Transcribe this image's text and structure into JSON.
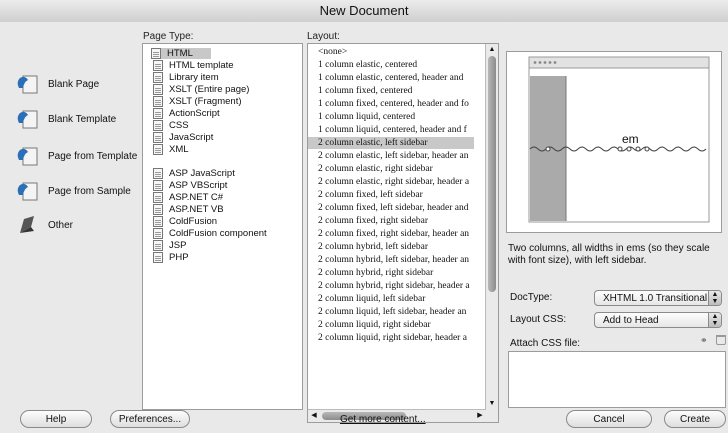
{
  "window": {
    "title": "New Document"
  },
  "categories": [
    {
      "label": "Blank Page",
      "icon": "blank-page-icon"
    },
    {
      "label": "Blank Template",
      "icon": "blank-template-icon"
    },
    {
      "label": "Page from Template",
      "icon": "page-from-template-icon"
    },
    {
      "label": "Page from Sample",
      "icon": "page-from-sample-icon"
    },
    {
      "label": "Other",
      "icon": "other-icon"
    }
  ],
  "page_type": {
    "heading": "Page Type:",
    "items": [
      "HTML",
      "HTML template",
      "Library item",
      "XSLT (Entire page)",
      "XSLT (Fragment)",
      "ActionScript",
      "CSS",
      "JavaScript",
      "XML",
      "ASP JavaScript",
      "ASP VBScript",
      "ASP.NET C#",
      "ASP.NET VB",
      "ColdFusion",
      "ColdFusion component",
      "JSP",
      "PHP"
    ],
    "selected": "HTML"
  },
  "layout": {
    "heading": "Layout:",
    "items": [
      "<none>",
      "1 column elastic, centered",
      "1 column elastic, centered, header and",
      "1 column fixed, centered",
      "1 column fixed, centered, header and fo",
      "1 column liquid, centered",
      "1 column liquid, centered, header and f",
      "2 column elastic, left sidebar",
      "2 column elastic, left sidebar, header an",
      "2 column elastic, right sidebar",
      "2 column elastic, right sidebar, header a",
      "2 column fixed, left sidebar",
      "2 column fixed, left sidebar, header and",
      "2 column fixed, right sidebar",
      "2 column fixed, right sidebar, header an",
      "2 column hybrid, left sidebar",
      "2 column hybrid, left sidebar, header an",
      "2 column hybrid, right sidebar",
      "2 column hybrid, right sidebar, header a",
      "2 column liquid, left sidebar",
      "2 column liquid, left sidebar, header an",
      "2 column liquid, right sidebar",
      "2 column liquid, right sidebar, header a"
    ],
    "selected": "2 column elastic, left sidebar"
  },
  "preview": {
    "label": "em",
    "description": "Two columns, all widths in ems (so they scale with font size), with left sidebar."
  },
  "settings": {
    "doctype_label": "DocType:",
    "doctype_value": "XHTML 1.0 Transitional",
    "layout_css_label": "Layout CSS:",
    "layout_css_value": "Add to Head",
    "attach_css_label": "Attach CSS file:"
  },
  "buttons": {
    "help": "Help",
    "preferences": "Preferences...",
    "get_more": "Get more content...",
    "cancel": "Cancel",
    "create": "Create"
  },
  "colors": {
    "selection": "#c8c8c8",
    "window": "#e9e9e9",
    "preview_sidebar": "#aaaaaa"
  }
}
